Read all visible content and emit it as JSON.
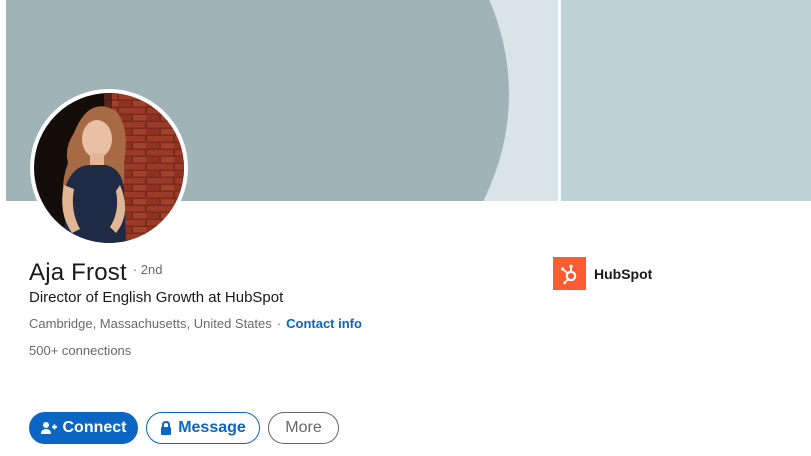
{
  "profile": {
    "name": "Aja Frost",
    "degree": "· 2nd",
    "headline": "Director of English Growth at HubSpot",
    "location": "Cambridge, Massachusetts, United States",
    "separator": "·",
    "contact_info_label": "Contact info",
    "connections": "500+ connections"
  },
  "company": {
    "name": "HubSpot",
    "logo_icon": "hubspot-sprocket-icon",
    "logo_color": "#ff5c35"
  },
  "actions": {
    "connect_label": "Connect",
    "connect_icon": "add-person-icon",
    "message_label": "Message",
    "message_icon": "lock-icon",
    "more_label": "More"
  },
  "colors": {
    "accent": "#0a66c2",
    "banner_dark": "#a0b3b6",
    "banner_light": "#bfd3d6"
  }
}
